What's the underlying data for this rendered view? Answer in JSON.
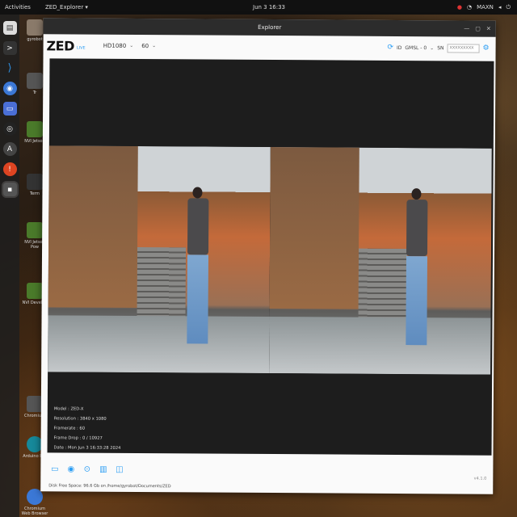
{
  "topbar": {
    "activities": "Activities",
    "app_name": "ZED_Explorer ▾",
    "clock": "Jun 3  16:33",
    "tray_power": "MAXN"
  },
  "desktop": {
    "labels": [
      "gyrobot",
      "Tr",
      "NVI Jetson",
      "Term",
      "NVI Jetson Pow",
      "NVI Develop",
      "Chromium",
      "Arduino IDE",
      "Chromium Web Browser"
    ]
  },
  "window": {
    "title": "Explorer"
  },
  "toolbar": {
    "logo": "ZED",
    "logo_sub": "LIVE",
    "resolution": "HD1080",
    "fps": "60",
    "camera_id": "ID",
    "interface": "GMSL - 0",
    "serial_label": "SN",
    "serial_placeholder": "XXXXXXXXX"
  },
  "overlay": {
    "model": "Model : ZED-X",
    "resolution": "Resolution : 3840 x 1080",
    "framerate": "Framerate : 60",
    "frame_drop": "Frame Drop : 0 / 10927",
    "date": "Date : Mon Jun 3 16:33:28 2024"
  },
  "footer": {
    "disk": "Disk Free Space: 96.6 Gb on /home/gyrobot/Documents/ZED",
    "version": "v4.1.0"
  },
  "colors": {
    "accent": "#2a9df4",
    "titlebar": "#2c2c2c",
    "video_bg": "#1d1d1d"
  }
}
